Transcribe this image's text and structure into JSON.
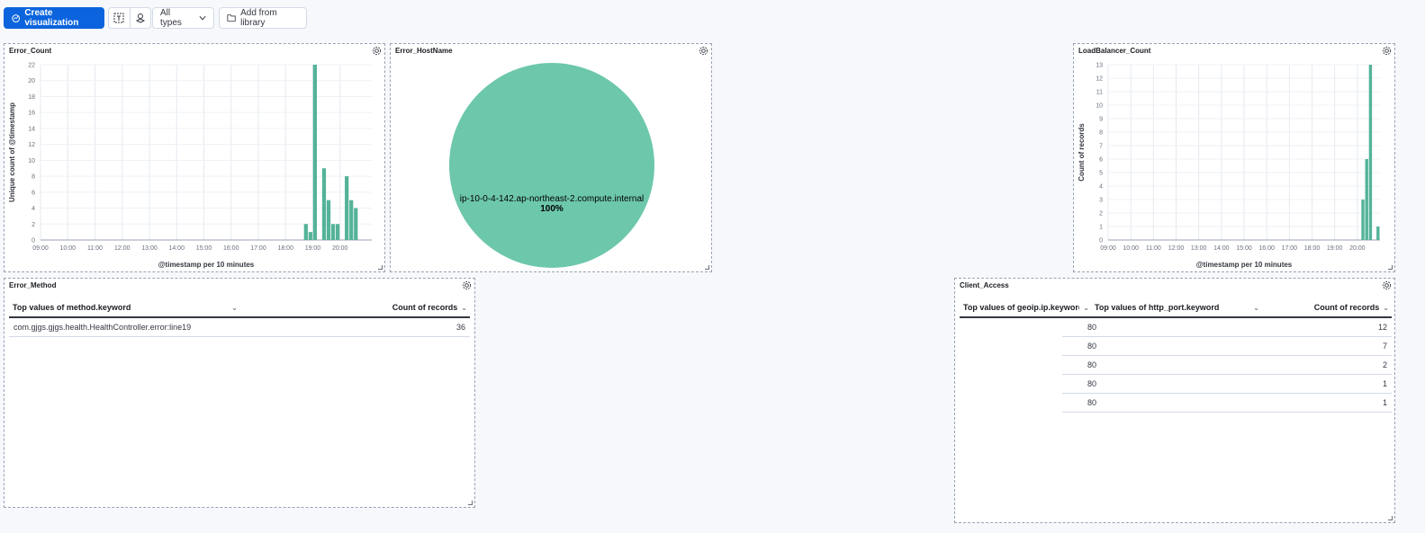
{
  "toolbar": {
    "create_label": "Create visualization",
    "types_label": "All types",
    "library_label": "Add from library"
  },
  "colors": {
    "bar": "#54b399",
    "pie": "#6dc7ab",
    "primary": "#0b64dd"
  },
  "panels": {
    "error_count": {
      "title": "Error_Count"
    },
    "error_hostname": {
      "title": "Error_HostName"
    },
    "lb_count": {
      "title": "LoadBalancer_Count"
    },
    "error_method": {
      "title": "Error_Method",
      "col1": "Top values of method.keyword",
      "col2": "Count of records",
      "rows": [
        {
          "method": "com.gjgs.gjgs.health.HealthController.error:line19",
          "count": "36"
        }
      ]
    },
    "client_access": {
      "title": "Client_Access",
      "col1": "Top values of geoip.ip.keyword",
      "col2": "Top values of http_port.keyword",
      "col3": "Count of records",
      "rows": [
        {
          "port": "80",
          "count": "12"
        },
        {
          "port": "80",
          "count": "7"
        },
        {
          "port": "80",
          "count": "2"
        },
        {
          "port": "80",
          "count": "1"
        },
        {
          "port": "80",
          "count": "1"
        }
      ]
    }
  },
  "chart_data": [
    {
      "type": "bar",
      "title": "Error_Count",
      "xlabel": "@timestamp per 10 minutes",
      "ylabel": "Unique count of @timestamp",
      "x_ticks": [
        "09:00",
        "10:00",
        "11:00",
        "12:00",
        "13:00",
        "14:00",
        "15:00",
        "16:00",
        "17:00",
        "18:00",
        "19:00",
        "20:00"
      ],
      "y_ticks": [
        0,
        2,
        4,
        6,
        8,
        10,
        12,
        14,
        16,
        18,
        20,
        22
      ],
      "ylim": [
        0,
        22
      ],
      "x": [
        "18:40",
        "18:50",
        "19:00",
        "19:10",
        "19:20",
        "19:30",
        "19:40",
        "19:50",
        "20:10",
        "20:20",
        "20:30"
      ],
      "values": [
        2,
        1,
        22,
        0,
        9,
        5,
        2,
        2,
        8,
        5,
        4
      ]
    },
    {
      "type": "pie",
      "title": "Error_HostName",
      "slices": [
        {
          "label": "ip-10-0-4-142.ap-northeast-2.compute.internal",
          "value": 100,
          "display": "100%"
        }
      ]
    },
    {
      "type": "bar",
      "title": "LoadBalancer_Count",
      "xlabel": "@timestamp per 10 minutes",
      "ylabel": "Count of records",
      "x_ticks": [
        "09:00",
        "10:00",
        "11:00",
        "12:00",
        "13:00",
        "14:00",
        "15:00",
        "16:00",
        "17:00",
        "18:00",
        "19:00",
        "20:00"
      ],
      "y_ticks": [
        0,
        1,
        2,
        3,
        4,
        5,
        6,
        7,
        8,
        9,
        10,
        11,
        12,
        13
      ],
      "ylim": [
        0,
        13
      ],
      "x": [
        "20:10",
        "20:20",
        "20:30",
        "20:50"
      ],
      "values": [
        3,
        6,
        13,
        1
      ]
    }
  ]
}
